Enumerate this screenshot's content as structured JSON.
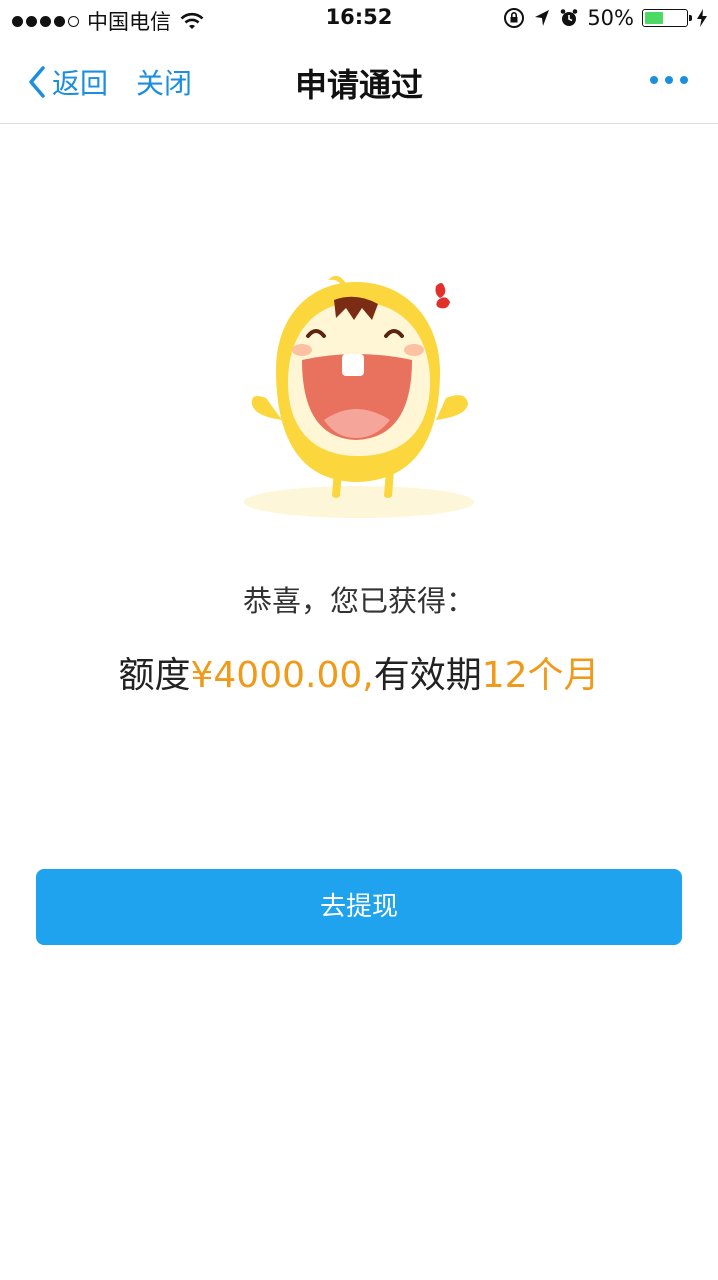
{
  "status_bar": {
    "carrier": "中国电信",
    "time": "16:52",
    "battery": "50%",
    "battery_level": 0.5,
    "icons": [
      "signal-dots",
      "wifi-icon",
      "rotation-lock-icon",
      "location-arrow-icon",
      "alarm-icon",
      "battery-icon",
      "charging-bolt-icon"
    ]
  },
  "nav": {
    "back_label": "返回",
    "close_label": "关闭",
    "title": "申请通过",
    "more_icon": "more-dots-icon"
  },
  "content": {
    "mascot_icon": "happy-yellow-mascot",
    "congrats_text": "恭喜，您已获得：",
    "quota_label": "额度",
    "quota_amount": "¥4000.00,",
    "validity_label": "有效期",
    "validity_value": "12个月"
  },
  "actions": {
    "withdraw_label": "去提现"
  },
  "colors": {
    "accent_blue": "#1fa3ee",
    "link_blue": "#1b8ee0",
    "highlight_orange": "#f09a1a",
    "battery_green": "#4cd964"
  }
}
